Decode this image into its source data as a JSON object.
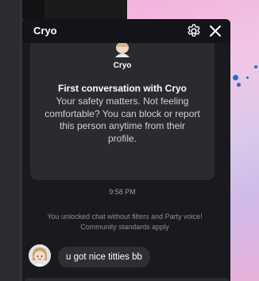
{
  "window": {
    "title": "Cryo"
  },
  "header": {
    "settings_icon": "gear-icon",
    "close_icon": "close-icon"
  },
  "intro_card": {
    "username": "Cryo",
    "heading": "First conversation with Cryo",
    "body": "Your safety matters. Not feeling comfortable? You can block or report this person anytime from their profile."
  },
  "conversation": {
    "timestamp": "9:58 PM",
    "system_message": "You unlocked chat without filters and Party voice! Community standards apply",
    "messages": [
      {
        "text": "u got nice titties bb"
      }
    ]
  },
  "colors": {
    "panel_bg": "#191a1f",
    "header_bg": "#131417",
    "card_bg": "#2a2b31",
    "bubble_bg": "#2e2f35"
  }
}
